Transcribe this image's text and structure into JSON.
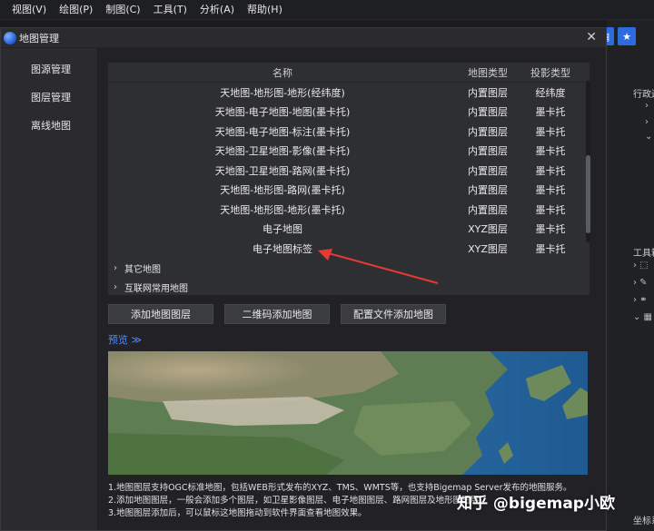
{
  "menubar": {
    "items": [
      "视图(V)",
      "绘图(P)",
      "制图(C)",
      "工具(T)",
      "分析(A)",
      "帮助(H)"
    ]
  },
  "dialog": {
    "title": "地图管理",
    "close_icon": "close-icon",
    "nav": [
      "图源管理",
      "图层管理",
      "离线地图"
    ]
  },
  "table": {
    "headers": [
      "名称",
      "地图类型",
      "投影类型"
    ],
    "rows": [
      {
        "name": "天地图-地形图-地形(经纬度)",
        "type": "内置图层",
        "proj": "经纬度"
      },
      {
        "name": "天地图-电子地图-地图(墨卡托)",
        "type": "内置图层",
        "proj": "墨卡托"
      },
      {
        "name": "天地图-电子地图-标注(墨卡托)",
        "type": "内置图层",
        "proj": "墨卡托"
      },
      {
        "name": "天地图-卫星地图-影像(墨卡托)",
        "type": "内置图层",
        "proj": "墨卡托"
      },
      {
        "name": "天地图-卫星地图-路网(墨卡托)",
        "type": "内置图层",
        "proj": "墨卡托"
      },
      {
        "name": "天地图-地形图-路网(墨卡托)",
        "type": "内置图层",
        "proj": "墨卡托"
      },
      {
        "name": "天地图-地形图-地形(墨卡托)",
        "type": "内置图层",
        "proj": "墨卡托"
      },
      {
        "name": "电子地图",
        "type": "XYZ图层",
        "proj": "墨卡托"
      },
      {
        "name": "电子地图标签",
        "type": "XYZ图层",
        "proj": "墨卡托"
      }
    ],
    "groups": [
      "其它地图",
      "互联网常用地图"
    ]
  },
  "buttons": {
    "add_layer": "添加地图图层",
    "qr_add": "二维码添加地图",
    "config_add": "配置文件添加地图"
  },
  "preview": {
    "label": "预览"
  },
  "notes": [
    "1.地图图层支持OGC标准地图，包括WEB形式发布的XYZ、TMS、WMTS等，也支持Bigemap Server发布的地图服务。",
    "2.添加地图图层，一般会添加多个图层，如卫星影像图层、电子地图图层、路网图层及地形图图层。",
    "3.地图图层添加后，可以鼠标这地图拖动到软件界面查看地图效果。"
  ],
  "right_panel": {
    "label1": "行政边",
    "label2": "工具箱",
    "label3": "坐标系"
  },
  "watermark": "知乎 @bigemap小欧",
  "colors": {
    "accent": "#2d6cdf",
    "link": "#4e8ef7",
    "arrow": "#e53935"
  }
}
